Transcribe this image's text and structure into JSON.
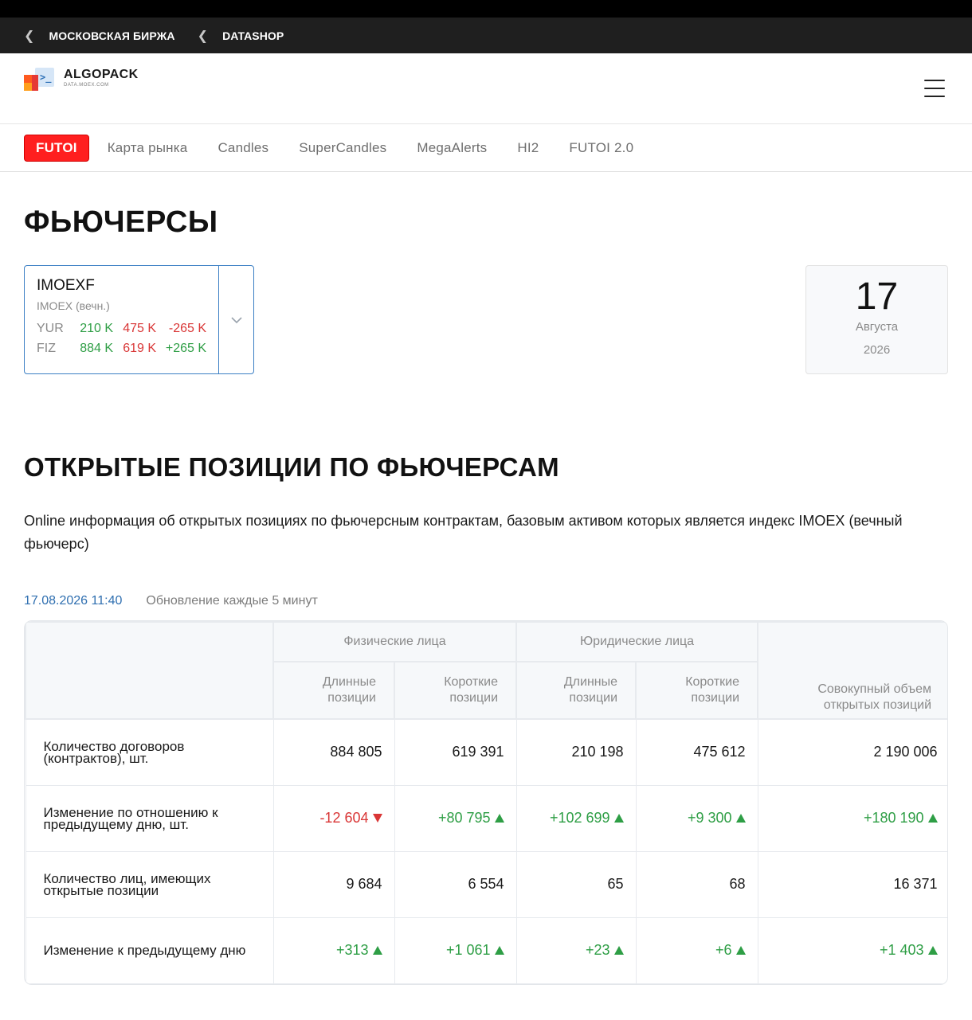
{
  "breadcrumbs": [
    {
      "label": "МОСКОВСКАЯ БИРЖА"
    },
    {
      "label": "DATASHOP"
    }
  ],
  "logo": {
    "name": "ALGOPACK",
    "sub": "DATA.MOEX.COM"
  },
  "tabs": [
    {
      "label": "FUTOI",
      "active": true
    },
    {
      "label": "Карта рынка"
    },
    {
      "label": "Candles"
    },
    {
      "label": "SuperCandles"
    },
    {
      "label": "MegaAlerts"
    },
    {
      "label": "HI2"
    },
    {
      "label": "FUTOI 2.0"
    }
  ],
  "page_title": "ФЬЮЧЕРСЫ",
  "instrument": {
    "code": "IMOEXF",
    "name": "IMOEX (вечн.)",
    "rows": [
      {
        "label": "YUR",
        "v1": "210 K",
        "v2": "475 K",
        "v3": "-265 K",
        "v3_sign": "neg"
      },
      {
        "label": "FIZ",
        "v1": "884 K",
        "v2": "619 K",
        "v3": "+265 K",
        "v3_sign": "pos"
      }
    ]
  },
  "date": {
    "day": "17",
    "month": "Августа",
    "year": "2026"
  },
  "section_title": "ОТКРЫТЫЕ ПОЗИЦИИ ПО ФЬЮЧЕРСАМ",
  "description": "Online информация об открытых позициях по фьючерсным контрактам, базовым активом которых является индекс IMOEX (вечный фьючерс)",
  "meta": {
    "timestamp": "17.08.2026 11:40",
    "update": "Обновление каждые 5 минут"
  },
  "table": {
    "groups": {
      "fiz": "Физические лица",
      "yur": "Юридические лица"
    },
    "columns": {
      "long": "Длинные позиции",
      "short": "Короткие позиции",
      "total": "Совокупный объем открытых позиций"
    },
    "rows": [
      {
        "label": "Количество договоров (контрактов), шт.",
        "cells": [
          {
            "v": "884 805",
            "c": ""
          },
          {
            "v": "619 391",
            "c": ""
          },
          {
            "v": "210 198",
            "c": ""
          },
          {
            "v": "475 612",
            "c": ""
          },
          {
            "v": "2 190 006",
            "c": ""
          }
        ]
      },
      {
        "label": "Изменение по отношению к предыдущему дню, шт.",
        "cells": [
          {
            "v": "-12 604",
            "c": "r"
          },
          {
            "v": "+80 795",
            "c": "g"
          },
          {
            "v": "+102 699",
            "c": "g"
          },
          {
            "v": "+9 300",
            "c": "g"
          },
          {
            "v": "+180 190",
            "c": "g"
          }
        ]
      },
      {
        "label": "Количество лиц, имеющих открытые позиции",
        "cells": [
          {
            "v": "9 684",
            "c": ""
          },
          {
            "v": "6 554",
            "c": ""
          },
          {
            "v": "65",
            "c": ""
          },
          {
            "v": "68",
            "c": ""
          },
          {
            "v": "16 371",
            "c": ""
          }
        ]
      },
      {
        "label": "Изменение к предыдущему дню",
        "cells": [
          {
            "v": "+313",
            "c": "g"
          },
          {
            "v": "+1 061",
            "c": "g"
          },
          {
            "v": "+23",
            "c": "g"
          },
          {
            "v": "+6",
            "c": "g"
          },
          {
            "v": "+1 403",
            "c": "g"
          }
        ]
      }
    ]
  },
  "colors": {
    "accent_red": "#ff1f1f",
    "positive": "#2e9e45",
    "negative": "#d93636",
    "link_blue": "#2f6fb0"
  }
}
